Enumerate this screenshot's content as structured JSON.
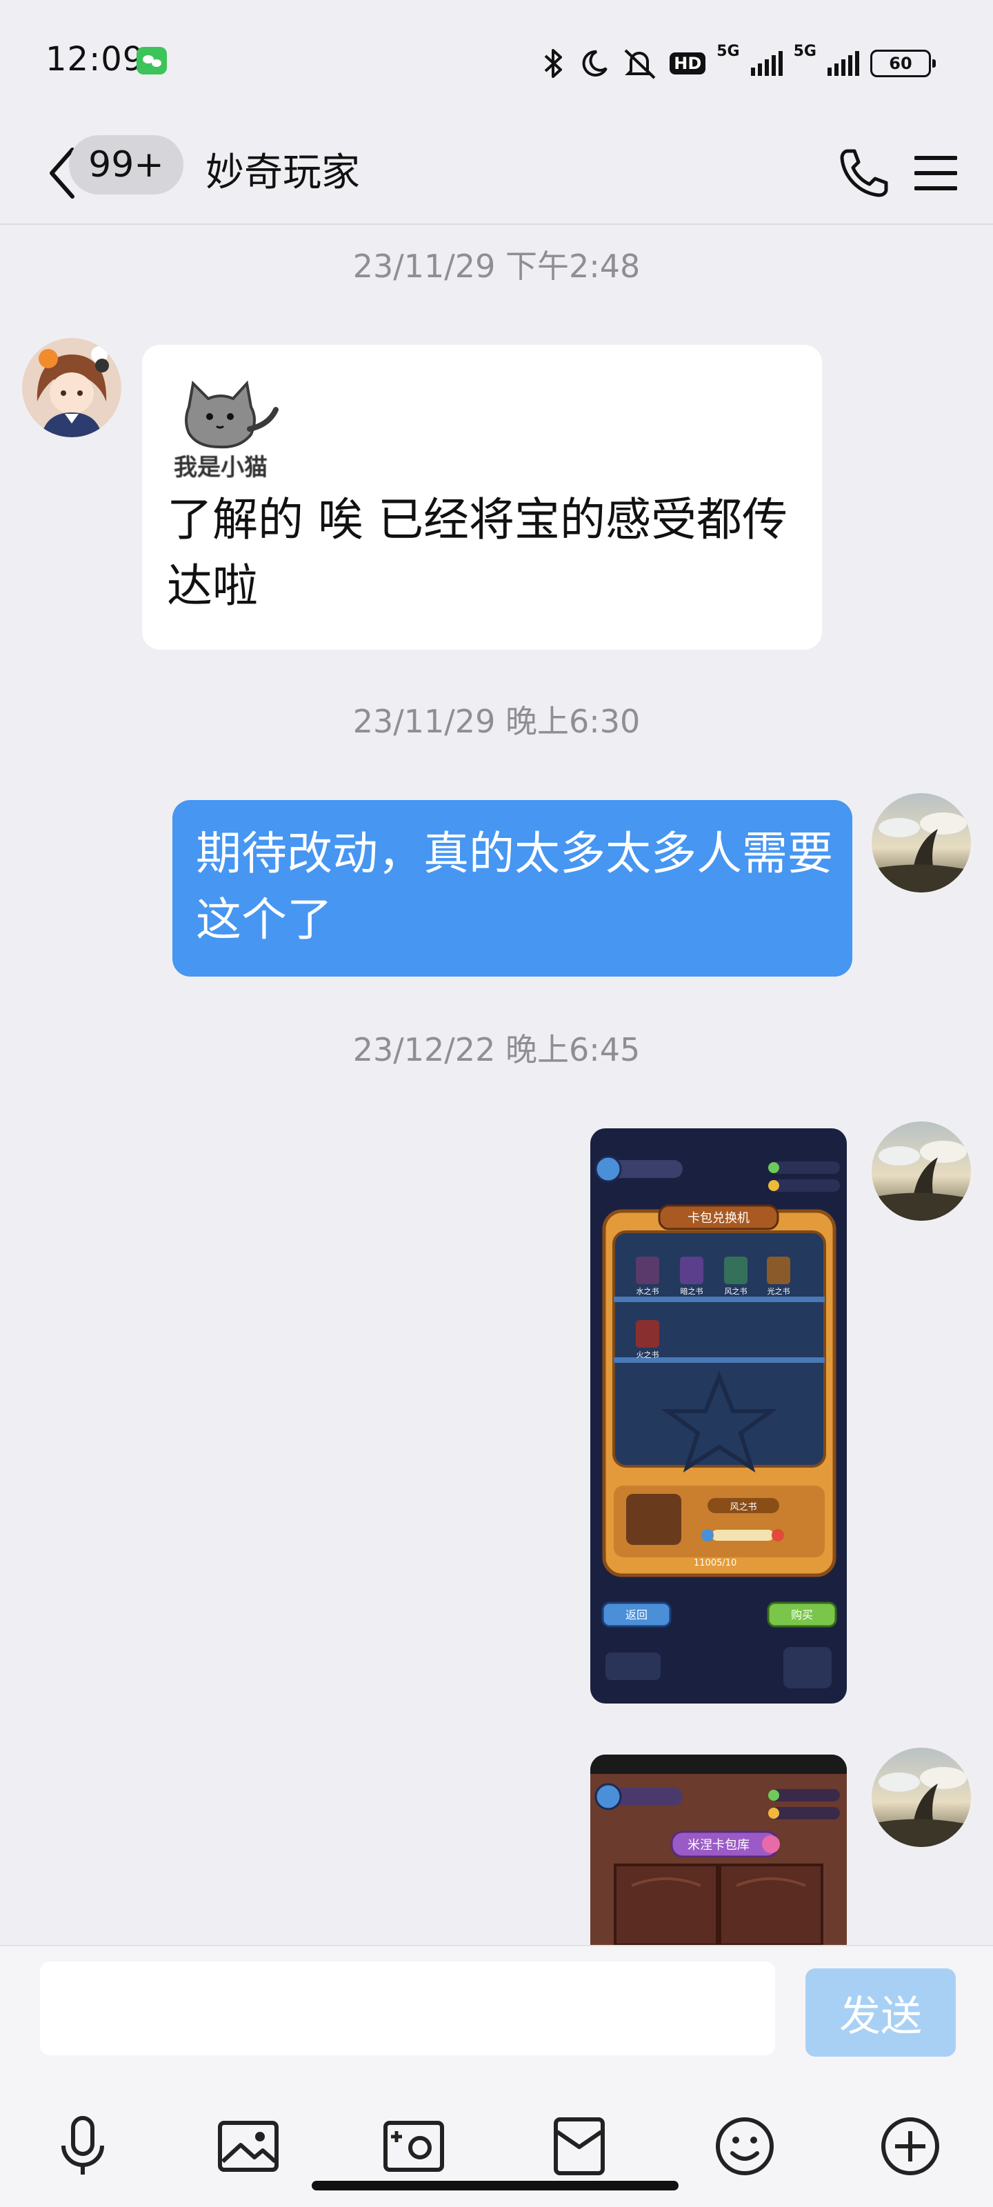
{
  "status_bar": {
    "time": "12:09",
    "hd_label": "HD",
    "net_labels": [
      "5G",
      "5G"
    ],
    "battery": "60"
  },
  "header": {
    "unread_count": "99+",
    "title": "妙奇玩家"
  },
  "messages": [
    {
      "timestamp": "23/11/29 下午2:48",
      "direction": "incoming",
      "sticker_label": "我是小猫",
      "text": "了解的 唉 已经将宝的感受都传达啦"
    },
    {
      "timestamp": "23/11/29 晚上6:30",
      "direction": "outgoing",
      "text": "期待改动，真的太多太多人需要这个了"
    },
    {
      "timestamp": "23/12/22 晚上6:45",
      "direction": "outgoing",
      "type": "image",
      "image_texts": [
        "卡包兑换机",
        "水之书",
        "暗之书",
        "风之书",
        "光之书",
        "火之书",
        "风之书",
        "11005/10",
        "返回",
        "购买"
      ]
    },
    {
      "direction": "outgoing",
      "type": "image",
      "image_texts": [
        "米涅卡包库"
      ]
    }
  ],
  "input": {
    "placeholder": "",
    "send_label": "发送"
  },
  "toolbar_icons": [
    "microphone-icon",
    "image-icon",
    "camera-icon",
    "red-packet-icon",
    "emoji-icon",
    "plus-icon"
  ],
  "colors": {
    "background": "#efeff3",
    "outgoing_bubble": "#4696f2",
    "incoming_bubble": "#ffffff",
    "send_button": "#a8d0f5"
  }
}
